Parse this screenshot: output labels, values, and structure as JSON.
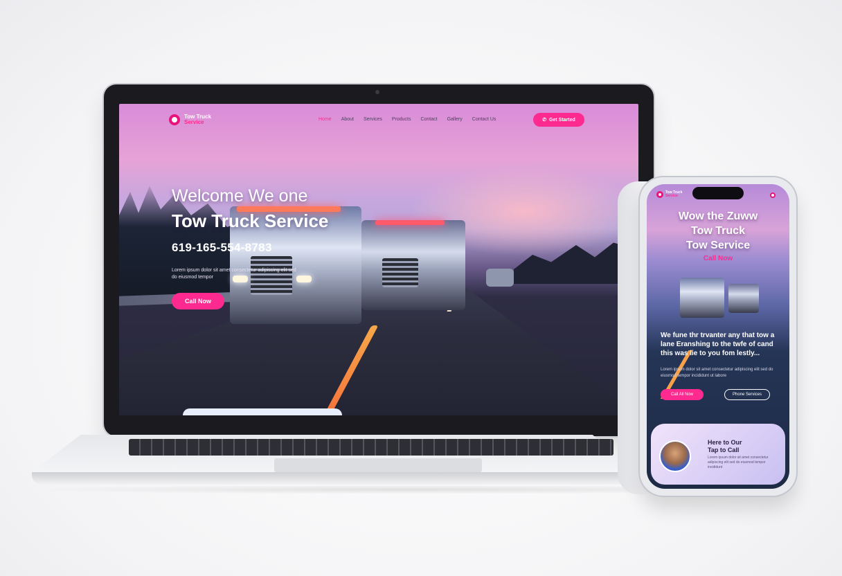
{
  "laptop": {
    "logo": {
      "line1": "Tow Truck",
      "line2": "Service"
    },
    "nav": [
      "Home",
      "About",
      "Services",
      "Products",
      "Contact",
      "Gallery",
      "Contact Us"
    ],
    "nav_cta": "Get Started",
    "hero": {
      "title_line1": "Welcome We one",
      "title_line2": "Tow Truck Service",
      "phone": "619-165-554-8783",
      "description": "Lorem ipsum dolor sit amet consectetur adipiscing elit sed do eiusmod tempor",
      "cta": "Call Now"
    }
  },
  "phone": {
    "logo": {
      "line1": "Tow Truck",
      "line2": "Service"
    },
    "title_lines": [
      "Wow the Zuww",
      "Tow Truck",
      "Tow Service"
    ],
    "call_label": "Call Now",
    "heading": "We fune thr trvanter any that tow a lane Eranshing to the twfe of cand this was lie to you fom lestly...",
    "description": "Lorem ipsum dolor sit amet consectetur adipiscing elit sed do eiusmod tempor incididunt ut labore",
    "btn_primary": "Call All Now",
    "btn_secondary": "Phone Services",
    "card": {
      "title_line1": "Here to Our",
      "title_line2": "Tap to Call",
      "description": "Lorem ipsum dolor sit amet consectetur adipiscing elit sed do eiusmod tempor incididunt"
    }
  },
  "colors": {
    "accent": "#ff2a8f",
    "sky_top": "#d98bd8",
    "road": "#2c2d3e"
  }
}
